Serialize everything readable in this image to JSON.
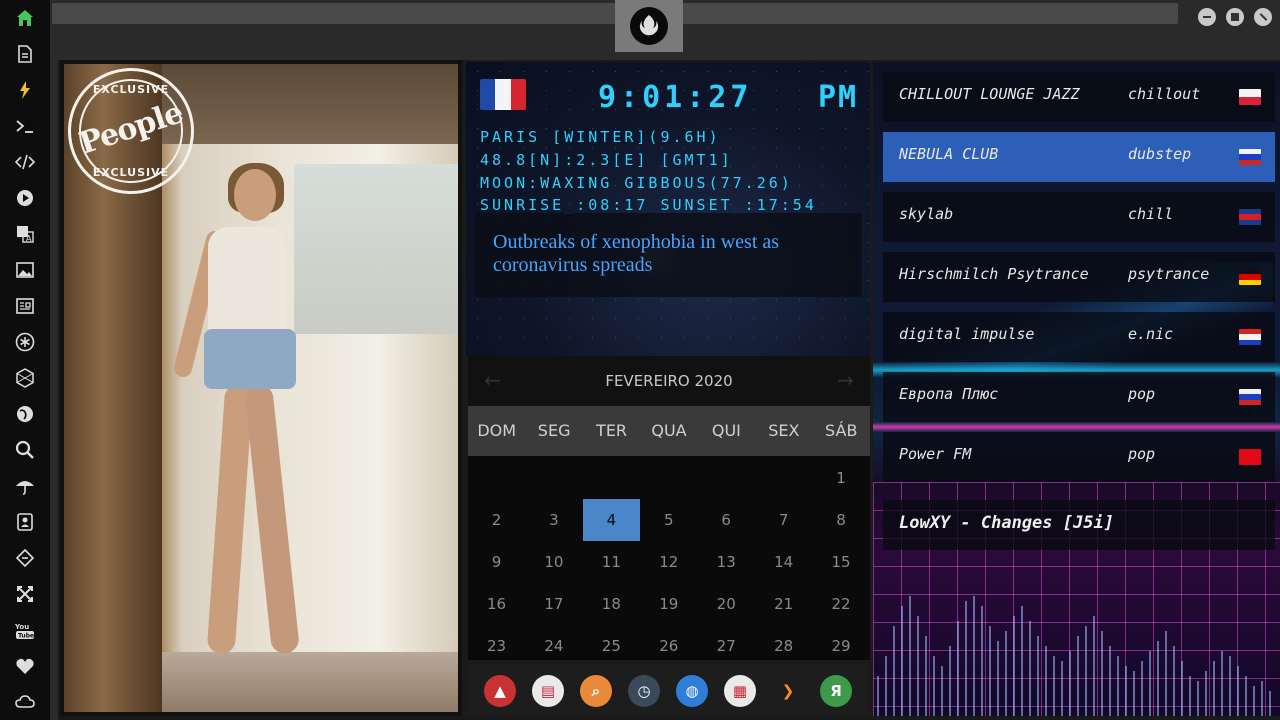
{
  "sidebar": {
    "icons": [
      "home-icon",
      "document-icon",
      "bolt-icon",
      "terminal-icon",
      "code-icon",
      "play-icon",
      "translate-icon",
      "image-icon",
      "news-icon",
      "asterisk-icon",
      "hexagon-icon",
      "globe-icon",
      "search-icon",
      "umbrella-icon",
      "contact-card-icon",
      "tag-icon",
      "shuffle-icon",
      "youtube-icon",
      "heart-icon",
      "cloud-icon"
    ],
    "accent": "#45c85a",
    "youtube_label": "You Tube"
  },
  "photo": {
    "stamp_top": "EXCLUSIVE",
    "stamp_brand": "People",
    "stamp_bottom": "EXCLUSIVE"
  },
  "clock": {
    "flag_colors": [
      "#1f4aa8",
      "#f4f4f4",
      "#d8242f"
    ],
    "time": "9:01:27",
    "ampm": "PM",
    "location": "PARIS [WINTER](9.6H)",
    "coords": "48.8[N]:2.3[E] [GMT1]",
    "moon": "MOON:WAXING GIBBOUS(77.26)",
    "sun": "SUNRISE_:08:17 SUNSET_:17:54",
    "headline": "Outbreaks of xenophobia in west as coronavirus spreads",
    "text_color": "#2fd0ff"
  },
  "calendar": {
    "title": "FEVEREIRO 2020",
    "prev": "←",
    "next": "→",
    "weekdays": [
      "DOM",
      "SEG",
      "TER",
      "QUA",
      "QUI",
      "SEX",
      "SÁB"
    ],
    "days": [
      "1",
      "2",
      "3",
      "4",
      "5",
      "6",
      "7",
      "8",
      "9",
      "10",
      "11",
      "12",
      "13",
      "14",
      "15",
      "16",
      "17",
      "18",
      "19",
      "20",
      "21",
      "22",
      "23",
      "24",
      "25",
      "26",
      "27",
      "28",
      "29"
    ],
    "first_weekday_index": 6,
    "today": "4",
    "today_color": "#4a86c8"
  },
  "dock": {
    "apps": [
      {
        "icon": "red-triangle-app-icon",
        "glyph": "▲",
        "color": "#c83232"
      },
      {
        "icon": "newspaper-app-icon",
        "glyph": "▤",
        "color": "#e9e9e9"
      },
      {
        "icon": "search-app-icon",
        "glyph": "⌕",
        "color": "#e88a3a"
      },
      {
        "icon": "clock-app-icon",
        "glyph": "◷",
        "color": "#3a4a5a"
      },
      {
        "icon": "globe-app-icon",
        "glyph": "◍",
        "color": "#2f7fd8"
      },
      {
        "icon": "calendar-app-icon",
        "glyph": "▦",
        "color": "#e9e9e9"
      },
      {
        "icon": "chevron-app-icon",
        "glyph": "❯",
        "color": "#1d1d1d"
      },
      {
        "icon": "yandex-app-icon",
        "glyph": "Я",
        "color": "#3c9a4a"
      }
    ]
  },
  "radio": {
    "stations": [
      {
        "name": "CHILLOUT LOUNGE JAZZ",
        "genre": "chillout",
        "flag": [
          "#f4f4f4",
          "#dc1f3a"
        ]
      },
      {
        "name": "NEBULA CLUB",
        "genre": "dubstep",
        "flag": [
          "#f4f4f4",
          "#1c3fbf",
          "#d6231e"
        ]
      },
      {
        "name": "skylab",
        "genre": "chill",
        "flag": [
          "#1a3c8c",
          "#d61f2a",
          "#1a3c8c"
        ]
      },
      {
        "name": "Hirschmilch Psytrance",
        "genre": "psytrance",
        "flag": [
          "#111111",
          "#dd0000",
          "#ffce00"
        ]
      },
      {
        "name": "digital impulse",
        "genre": "e.nic",
        "flag": [
          "#d6231e",
          "#f4f4f4",
          "#1c3fbf"
        ]
      },
      {
        "name": "Европа Плюс",
        "genre": "pop",
        "flag": [
          "#f4f4f4",
          "#1c3fbf",
          "#d6231e"
        ]
      },
      {
        "name": "Power FM",
        "genre": "pop",
        "flag": [
          "#e30a17",
          "#e30a17"
        ]
      }
    ],
    "active_index": 1,
    "now_playing": "LowXY - Changes [J5i]",
    "active_color": "#2e5fb8"
  },
  "window": {
    "controls": [
      "minimize-icon",
      "maximize-icon",
      "close-icon"
    ],
    "emblem": "rebel-alliance-icon"
  }
}
